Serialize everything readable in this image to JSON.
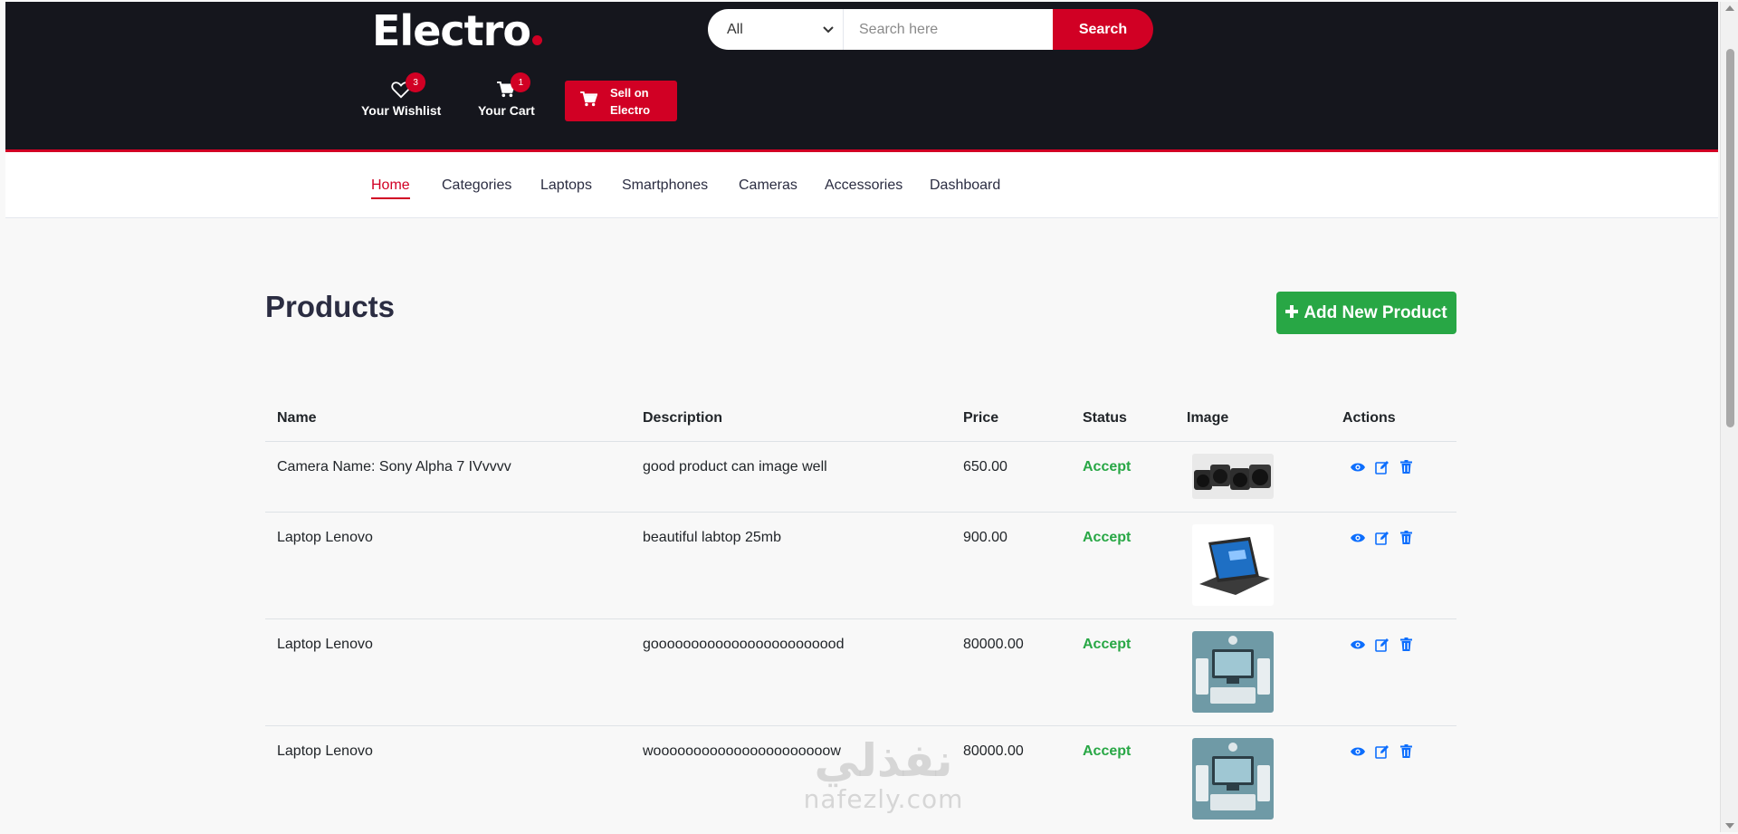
{
  "header": {
    "logo": "Electro",
    "search": {
      "category": "All",
      "placeholder": "Search here",
      "button": "Search"
    },
    "wishlist": {
      "label": "Your Wishlist",
      "count": "3"
    },
    "cart": {
      "label": "Your Cart",
      "count": "1"
    },
    "sell": {
      "line1": "Sell on",
      "line2": "Electro"
    }
  },
  "nav": [
    "Home",
    "Categories",
    "Laptops",
    "Smartphones",
    "Cameras",
    "Accessories",
    "Dashboard"
  ],
  "page": {
    "title": "Products",
    "add_button": "Add New Product"
  },
  "table": {
    "headers": [
      "Name",
      "Description",
      "Price",
      "Status",
      "Image",
      "Actions"
    ],
    "rows": [
      {
        "name": "Camera Name: Sony Alpha 7 IVvvvv",
        "description": "good product can image well",
        "price": "650.00",
        "status": "Accept",
        "image": "cameras"
      },
      {
        "name": "Laptop Lenovo",
        "description": "beautiful labtop 25mb",
        "price": "900.00",
        "status": "Accept",
        "image": "laptop"
      },
      {
        "name": "Laptop Lenovo",
        "description": "goooooooooooooooooooooood",
        "price": "80000.00",
        "status": "Accept",
        "image": "devices"
      },
      {
        "name": "Laptop Lenovo",
        "description": "woooooooooooooooooooooow",
        "price": "80000.00",
        "status": "Accept",
        "image": "devices"
      }
    ]
  },
  "watermark": {
    "arabic": "نفذلي",
    "latin": "nafezly.com"
  },
  "colors": {
    "brand": "#d10024",
    "header_bg": "#15161d",
    "success": "#28a745",
    "action_blue": "#0d6efd"
  }
}
